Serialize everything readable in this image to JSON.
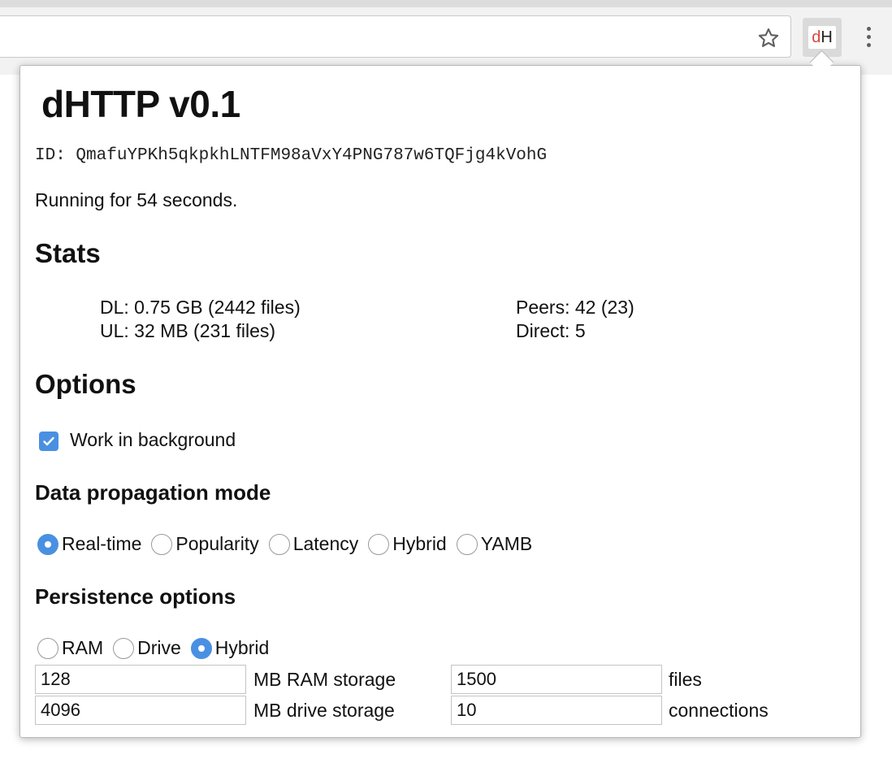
{
  "browser": {
    "extension_icon": {
      "letter_d": "d",
      "letter_h": "H"
    },
    "icons": {
      "bookmark": "star-icon",
      "menu": "more-vert-icon"
    }
  },
  "popup": {
    "title": "dHTTP v0.1",
    "peer_id": "ID: QmafuYPKh5qkpkhLNTFM98aVxY4PNG787w6TQFjg4kVohG",
    "status": "Running for 54 seconds.",
    "stats": {
      "heading": "Stats",
      "dl": "DL: 0.75 GB (2442 files)",
      "ul": "UL: 32 MB (231 files)",
      "peers": "Peers: 42 (23)",
      "direct": "Direct: 5"
    },
    "options": {
      "heading": "Options",
      "work_in_background": {
        "label": "Work in background",
        "checked": true
      },
      "propagation": {
        "heading": "Data propagation mode",
        "options": [
          "Real-time",
          "Popularity",
          "Latency",
          "Hybrid",
          "YAMB"
        ],
        "selected": "Real-time"
      },
      "persistence": {
        "heading": "Persistence options",
        "options": [
          "RAM",
          "Drive",
          "Hybrid"
        ],
        "selected": "Hybrid",
        "ram_storage": {
          "value": "128",
          "unit": "MB RAM storage"
        },
        "drive_storage": {
          "value": "4096",
          "unit": "MB drive storage"
        },
        "files": {
          "value": "1500",
          "unit": "files"
        },
        "connections": {
          "value": "10",
          "unit": "connections"
        }
      }
    },
    "colors": {
      "accent": "#4a90e2",
      "extension_d": "#d9453f"
    }
  }
}
